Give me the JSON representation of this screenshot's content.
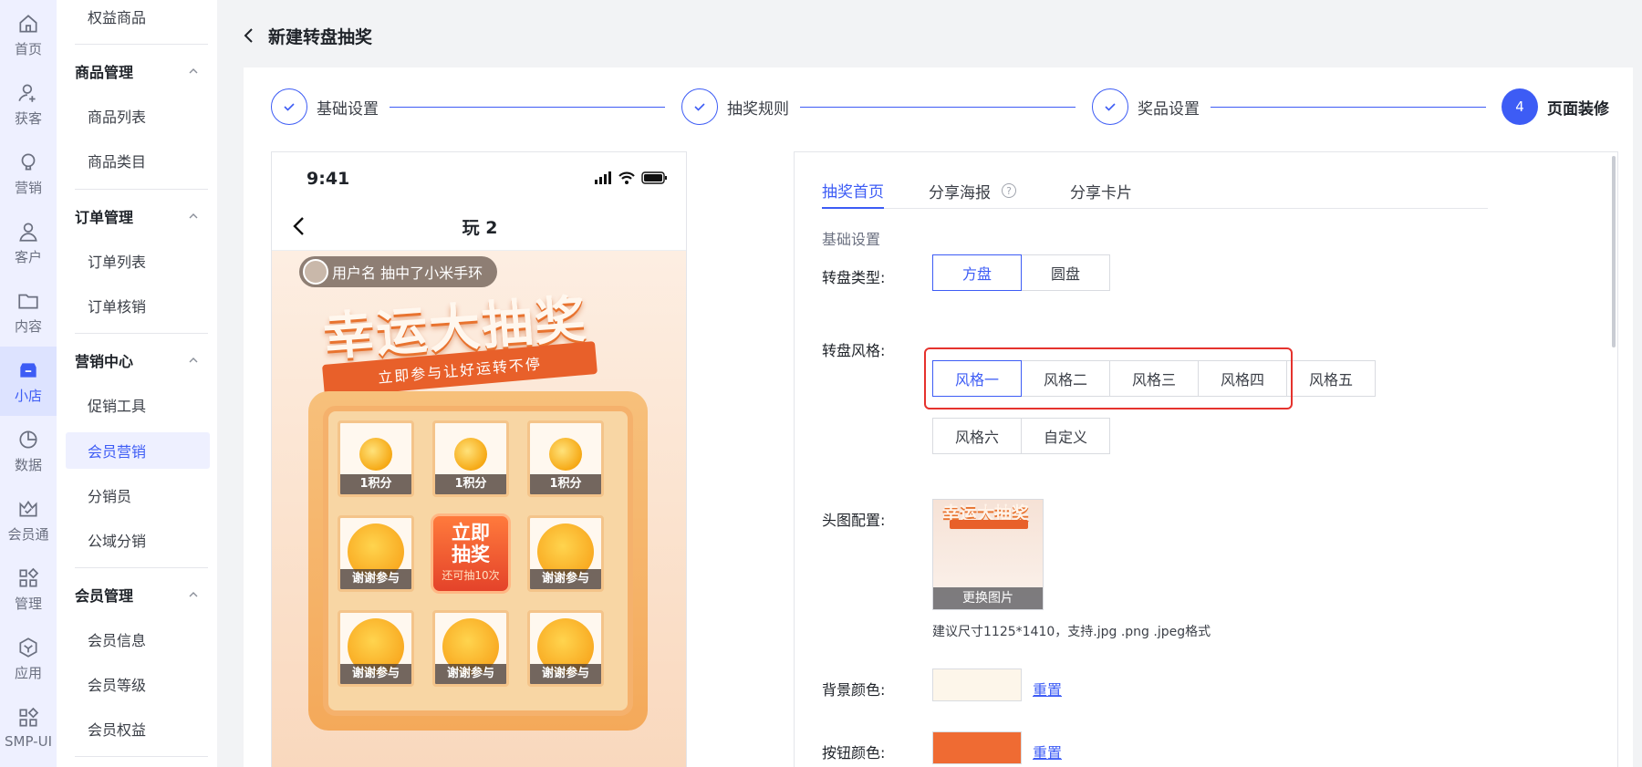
{
  "rail": [
    {
      "label": "首页",
      "icon": "home-icon"
    },
    {
      "label": "获客",
      "icon": "user-add-icon"
    },
    {
      "label": "营销",
      "icon": "bulb-icon"
    },
    {
      "label": "客户",
      "icon": "person-icon"
    },
    {
      "label": "内容",
      "icon": "folder-icon"
    },
    {
      "label": "小店",
      "icon": "shop-icon"
    },
    {
      "label": "数据",
      "icon": "pie-chart-icon"
    },
    {
      "label": "会员通",
      "icon": "crown-icon"
    },
    {
      "label": "管理",
      "icon": "grid-icon"
    },
    {
      "label": "应用",
      "icon": "cube-icon"
    },
    {
      "label": "SMP-UI",
      "icon": "apps-icon"
    }
  ],
  "sidebar": {
    "top_item": "权益商品",
    "groups": [
      {
        "title": "商品管理",
        "items": [
          "商品列表",
          "商品类目"
        ]
      },
      {
        "title": "订单管理",
        "items": [
          "订单列表",
          "订单核销"
        ]
      },
      {
        "title": "营销中心",
        "items": [
          "促销工具",
          "会员营销",
          "分销员",
          "公域分销"
        ]
      },
      {
        "title": "会员管理",
        "items": [
          "会员信息",
          "会员等级",
          "会员权益"
        ]
      }
    ]
  },
  "header": {
    "title": "新建转盘抽奖"
  },
  "steps": [
    {
      "label": "基础设置",
      "state": "done"
    },
    {
      "label": "抽奖规则",
      "state": "done"
    },
    {
      "label": "奖品设置",
      "state": "done"
    },
    {
      "number": "4",
      "label": "页面装修",
      "state": "current"
    }
  ],
  "preview": {
    "time": "9:41",
    "nav_title": "玩 2",
    "ticker": "用户名 抽中了小米手环",
    "banner_title": "幸运大抽奖",
    "banner_sub": "立即参与让好运转不停",
    "prizes": [
      "1积分",
      "1积分",
      "1积分",
      "谢谢参与",
      "",
      "谢谢参与",
      "谢谢参与",
      "谢谢参与",
      "谢谢参与"
    ],
    "draw_button": {
      "line1": "立即",
      "line2": "抽奖",
      "note": "还可抽10次"
    }
  },
  "panel": {
    "tabs": [
      "抽奖首页",
      "分享海报",
      "分享卡片"
    ],
    "tab_help": "?",
    "section_title": "基础设置",
    "type_label": "转盘类型:",
    "type_options": [
      "方盘",
      "圆盘"
    ],
    "style_label": "转盘风格:",
    "style_options": [
      "风格一",
      "风格二",
      "风格三",
      "风格四",
      "风格五",
      "风格六",
      "自定义"
    ],
    "header_label": "头图配置:",
    "thumb_title": "幸运大抽奖",
    "change_image": "更换图片",
    "hint": "建议尺寸1125*1410，支持.jpg .png .jpeg格式",
    "bg_label": "背景颜色:",
    "btn_label": "按钮颜色:",
    "reset": "重置",
    "colors": {
      "background": "#fdf6ea",
      "button": "#ef6b33"
    }
  },
  "colors": {
    "accent": "#3d5cf5",
    "highlight": "#e5322d"
  }
}
